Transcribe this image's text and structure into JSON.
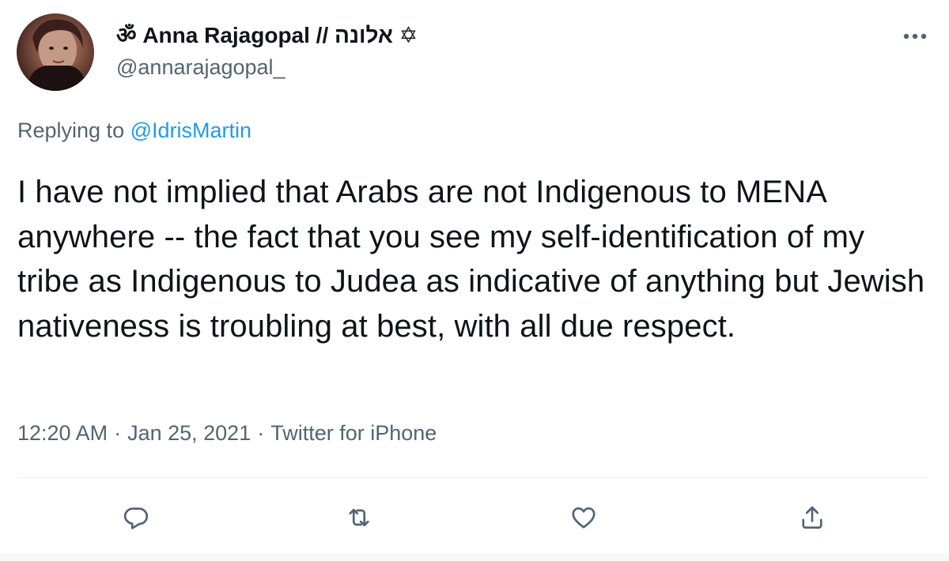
{
  "author": {
    "display_name": "ॐ Anna Rajagopal // אלונה ✡",
    "handle": "@annarajagopal_"
  },
  "reply": {
    "prefix": "Replying to",
    "mention": "@IdrisMartin"
  },
  "tweet": {
    "text": "I have not implied that Arabs are not Indigenous to MENA anywhere -- the fact that you see my self-identification of my tribe as Indigenous to Judea as indicative of anything but Jewish nativeness is troubling at best, with all due respect."
  },
  "meta": {
    "time": "12:20 AM",
    "date": "Jan 25, 2021",
    "source": "Twitter for iPhone",
    "separator": "·"
  },
  "icons": {
    "more": "more-dots-icon",
    "reply": "reply-bubble-icon",
    "retweet": "retweet-icon",
    "like": "heart-icon",
    "share": "share-icon"
  },
  "colors": {
    "text": "#0f1419",
    "secondary": "#536471",
    "link": "#1d9bf0",
    "divider": "#eff3f4"
  }
}
